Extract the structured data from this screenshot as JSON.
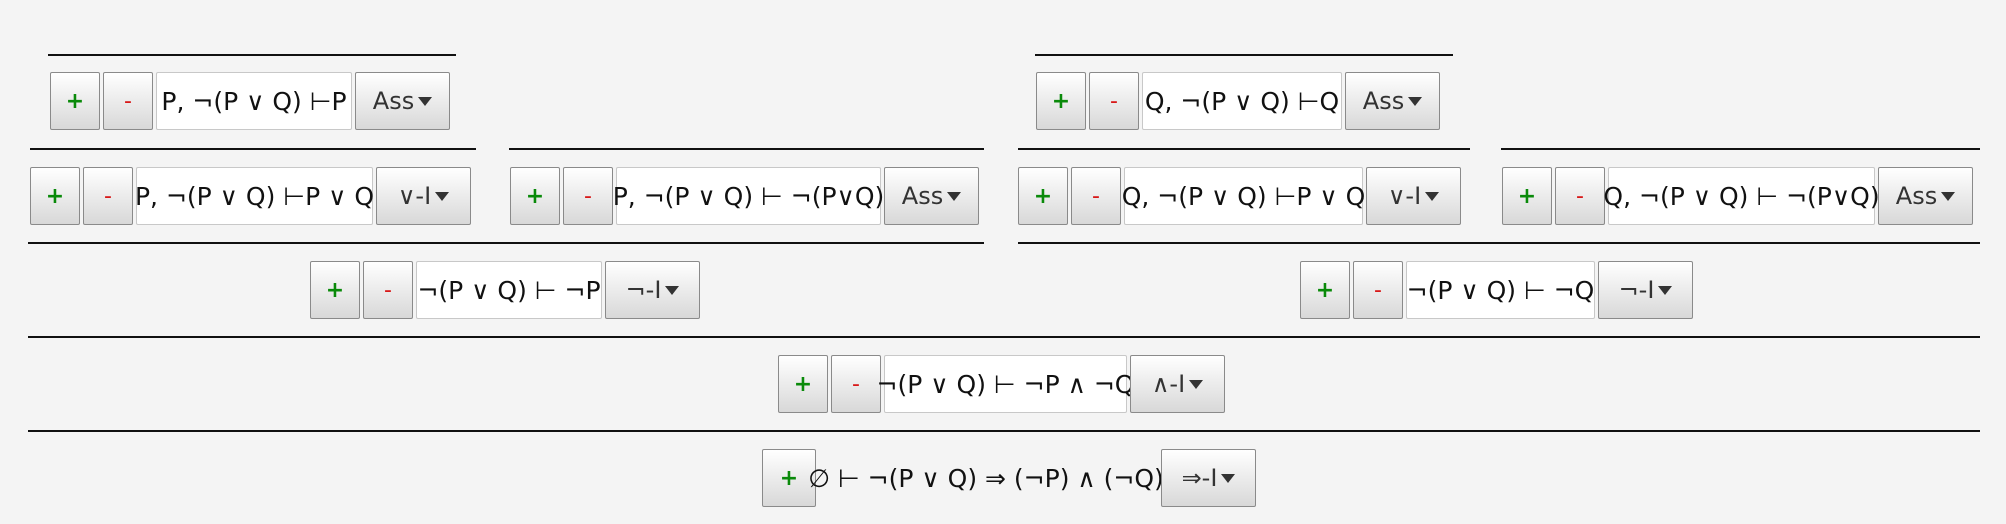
{
  "buttons": {
    "plus": "+",
    "minus": "-"
  },
  "nodes": {
    "n1": {
      "sequent": "P, ¬(P ∨ Q) ⊢P",
      "rule": "Ass"
    },
    "n2": {
      "sequent": "Q, ¬(P ∨ Q) ⊢Q",
      "rule": "Ass"
    },
    "n3": {
      "sequent": "P, ¬(P ∨ Q) ⊢P ∨ Q",
      "rule": "∨-I"
    },
    "n4": {
      "sequent": "P, ¬(P ∨ Q) ⊢ ¬(P∨Q)",
      "rule": "Ass"
    },
    "n5": {
      "sequent": "Q, ¬(P ∨ Q) ⊢P ∨ Q",
      "rule": "∨-I"
    },
    "n6": {
      "sequent": "Q, ¬(P ∨ Q) ⊢ ¬(P∨Q)",
      "rule": "Ass"
    },
    "n7": {
      "sequent": "¬(P ∨ Q) ⊢ ¬P",
      "rule": "¬-I"
    },
    "n8": {
      "sequent": "¬(P ∨ Q) ⊢ ¬Q",
      "rule": "¬-I"
    },
    "n9": {
      "sequent": "¬(P ∨ Q) ⊢ ¬P ∧ ¬Q",
      "rule": "∧-I"
    },
    "n10": {
      "sequent": "∅ ⊢ ¬(P ∨ Q) ⇒ (¬P) ∧ (¬Q)",
      "rule": "⇒-I"
    }
  }
}
